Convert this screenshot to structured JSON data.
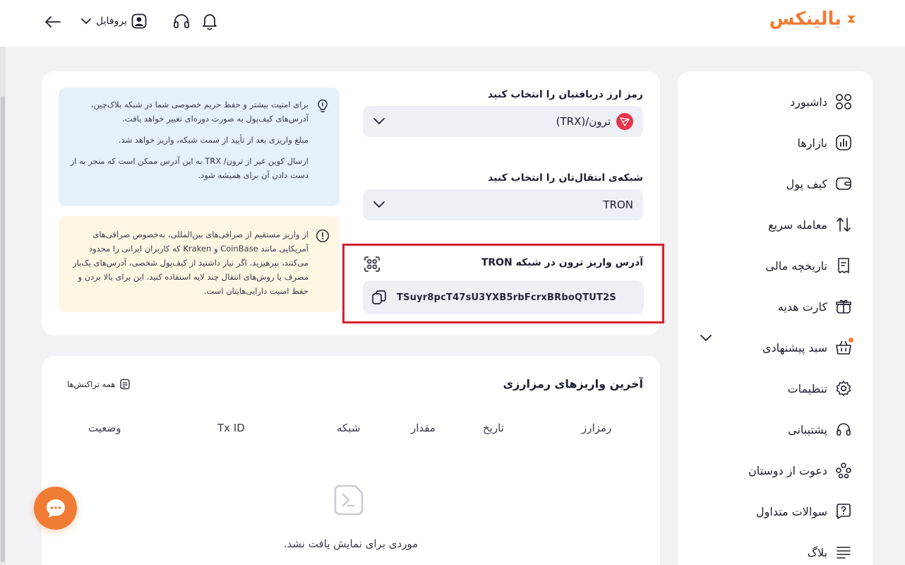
{
  "brand": {
    "logo_text": "بالینکس",
    "accent": "#f07b33"
  },
  "topbar": {
    "profile_label": "پروفایل"
  },
  "sidebar": {
    "items": [
      {
        "label": "داشبورد",
        "icon": "grid-icon"
      },
      {
        "label": "بازارها",
        "icon": "chart-icon"
      },
      {
        "label": "کیف پول",
        "icon": "wallet-icon"
      },
      {
        "label": "معامله سریع",
        "icon": "swap-icon"
      },
      {
        "label": "تاریخچه مالی",
        "icon": "receipt-icon"
      },
      {
        "label": "کارت هدیه",
        "icon": "gift-icon"
      },
      {
        "label": "سبد پیشنهادی",
        "icon": "basket-icon"
      },
      {
        "label": "تنظیمات",
        "icon": "gear-icon"
      },
      {
        "label": "پشتیبانی",
        "icon": "headset-icon"
      },
      {
        "label": "دعوت از دوستان",
        "icon": "users-icon"
      },
      {
        "label": "سوالات متداول",
        "icon": "question-icon"
      },
      {
        "label": "بلاگ",
        "icon": "blog-icon"
      }
    ]
  },
  "deposit": {
    "currency_label": "رمز ارز دریافتیان را انتخاب کنید",
    "currency_value": "ترون/(TRX)",
    "network_label": "شبکه‌ی انتقال‌تان را انتخاب کنید",
    "network_value": "TRON",
    "address_title": "آدرس واریز ترون در شبکه TRON",
    "address_value": "TSuyr8pcT47sU3YXB5rbFcrxBRboQTUT2S",
    "highlight_color": "#d3202d"
  },
  "info_blue": {
    "p1": "برای امنیت بیشتر و حفظ حریم خصوصی شما در شبکه بلاک‌چین، آدرس‌های کیف‌پول به صورت دوره‌ای تغییر خواهد یافت.",
    "p2": "مبلغ واریزی بعد از تأیید از سمت شبکه، واریز خواهد شد.",
    "p3": "ارسال کوین غیر از ترون/ TRX به این آدرس ممکن است که منجر به از دست دادن آن برای همیشه شود."
  },
  "info_yellow": {
    "p1": "از واریز مستقیم از صرافی‌های بین‌المللی، به‌خصوص صرافی‌های آمریکایی مانند CoinBase و Kraken که کاربران ایرانی را محدود می‌کنند، بپرهیزید. اگر نیاز داشتید از کیف‌پول شخصی، آدرس‌های یک‌بار مصرف یا روش‌های انتقال چند لایه استفاده کنید. این برای بالا بردن و حفظ امنیت دارایی‌هایتان است."
  },
  "transactions": {
    "title": "آخرین واریزهای رمزارزی",
    "all_link": "همه تراکنش‌ها",
    "columns": [
      "رمزارز",
      "تاریخ",
      "مقدار",
      "شبکه",
      "Tx ID",
      "وضعیت"
    ],
    "empty_text": "موردی برای نمایش یافت نشد."
  }
}
